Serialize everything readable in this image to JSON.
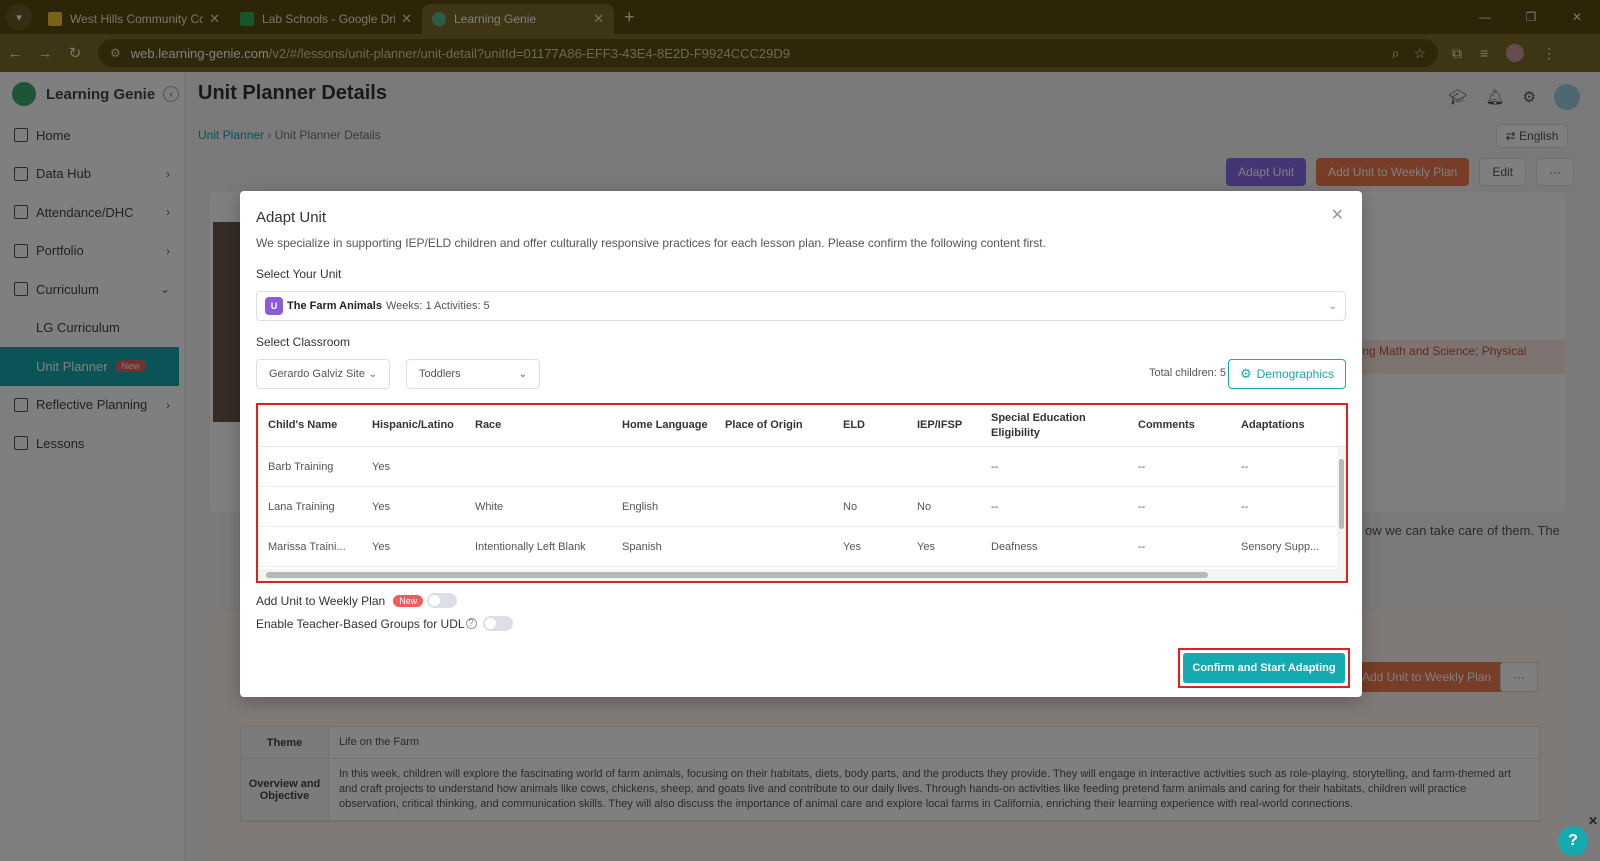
{
  "browser": {
    "tabs": [
      {
        "title": "West Hills Community College",
        "favicon_color": "#f4c430"
      },
      {
        "title": "Lab Schools - Google Drive",
        "favicon_color": "#34a853"
      },
      {
        "title": "Learning Genie",
        "favicon_color": "#5bb98c",
        "active": true
      }
    ],
    "url_host": "web.learning-genie.com",
    "url_path": "/v2/#/lessons/unit-planner/unit-detail?unitId=01177A86-EFF3-43E4-8E2D-F9924CCC29D9"
  },
  "sidebar": {
    "brand": "Learning Genie",
    "items": [
      {
        "label": "Home"
      },
      {
        "label": "Data Hub"
      },
      {
        "label": "Attendance/DHC"
      },
      {
        "label": "Portfolio"
      },
      {
        "label": "Curriculum"
      }
    ],
    "sub_items": [
      {
        "label": "LG Curriculum"
      },
      {
        "label": "Unit Planner",
        "badge": "New"
      }
    ],
    "items_after": [
      {
        "label": "Reflective Planning"
      },
      {
        "label": "Lessons"
      }
    ]
  },
  "page": {
    "title": "Unit Planner Details",
    "breadcrumb": [
      "Unit Planner",
      "Unit Planner Details"
    ],
    "language": "English",
    "actions": {
      "adapt": "Adapt Unit",
      "add_weekly": "Add Unit to Weekly Plan",
      "edit": "Edit",
      "more": "···"
    },
    "bg_side_text": "ding Math and Science; Physical",
    "bg_para_text": "ow we can take care of them. The",
    "bg_table": [
      {
        "key": "Theme",
        "value": "Life on the Farm"
      },
      {
        "key": "Overview and Objective",
        "value": "In this week, children will explore the fascinating world of farm animals, focusing on their habitats, diets, body parts, and the products they provide. They will engage in interactive activities such as role-playing, storytelling, and farm-themed art and craft projects to understand how animals like cows, chickens, sheep, and goats live and contribute to our daily lives. Through hands-on activities like feeding pretend farm animals and caring for their habitats, children will practice observation, critical thinking, and communication skills. They will also discuss the importance of animal care and explore local farms in California, enriching their learning experience with real-world connections."
      }
    ]
  },
  "modal": {
    "title": "Adapt Unit",
    "description": "We specialize in supporting IEP/ELD children and offer culturally responsive practices for each lesson plan. Please confirm the following content first.",
    "unit_label": "Select Your Unit",
    "unit": {
      "badge": "U",
      "name": "The Farm Animals",
      "meta": "Weeks: 1 Activities: 5"
    },
    "classroom_label": "Select Classroom",
    "site": "Gerardo Galviz Site",
    "classroom": "Toddlers",
    "total_children": "Total children: 5",
    "demographics": "Demographics",
    "columns": [
      "Child's Name",
      "Hispanic/Latino",
      "Race",
      "Home Language",
      "Place of Origin",
      "ELD",
      "IEP/IFSP",
      "Special Education Eligibility",
      "Comments",
      "Adaptations"
    ],
    "rows": [
      [
        "Barb Training",
        "Yes",
        "",
        "",
        "",
        "",
        "",
        "--",
        "--",
        "--"
      ],
      [
        "Lana Training",
        "Yes",
        "White",
        "English",
        "",
        "No",
        "No",
        "--",
        "--",
        "--"
      ],
      [
        "Marissa Traini...",
        "Yes",
        "Intentionally Left Blank",
        "Spanish",
        "",
        "Yes",
        "Yes",
        "Deafness",
        "--",
        "Sensory Supp..."
      ]
    ],
    "toggle_weekly": "Add Unit to Weekly Plan",
    "toggle_weekly_badge": "New",
    "toggle_udl": "Enable Teacher-Based Groups for UDL",
    "confirm": "Confirm and Start Adapting"
  },
  "help": "?"
}
